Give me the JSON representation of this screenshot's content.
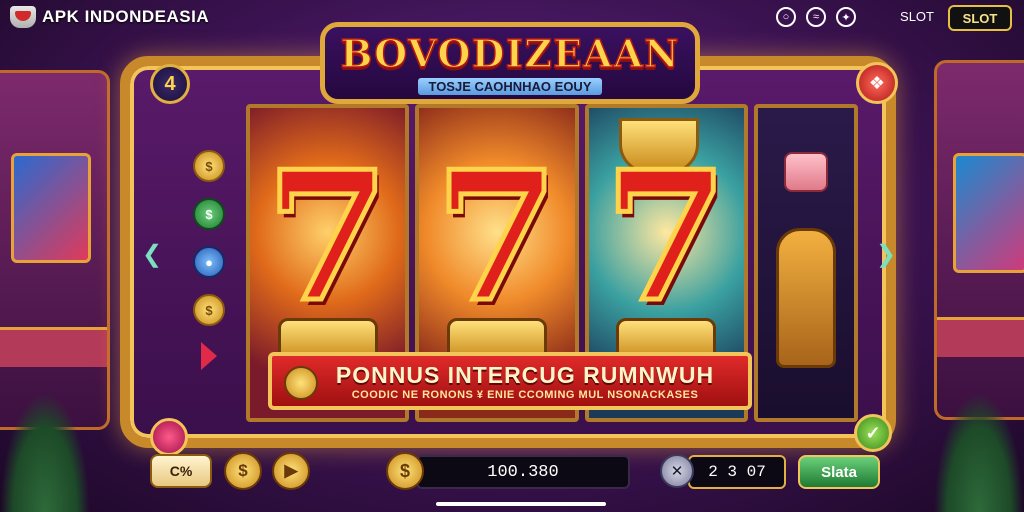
{
  "header": {
    "brand": "APK INDONDEASIA",
    "icons": [
      "chat-icon",
      "signal-icon",
      "gift-icon"
    ],
    "slot_label": "SLOT",
    "slot_button": "SLOT"
  },
  "machine": {
    "title": "BOVODIZEAAN",
    "subtitle": "TOSJE CAOHNHAO EOUY",
    "level": "4",
    "reels": [
      {
        "symbol": "7"
      },
      {
        "symbol": "7"
      },
      {
        "symbol": "7"
      }
    ],
    "left_symbols": [
      "coin-icon",
      "green-coin-icon",
      "blue-coin-icon",
      "coin-icon",
      "red-gem-icon"
    ]
  },
  "bonus": {
    "title": "PONNUS INTERCUG RUMNWUH",
    "subtitle": "COODIC NE RONONS ¥ ENIE CCOMING MUL NSONACKASES"
  },
  "footer": {
    "bet_label": "C%",
    "balance": "100.380",
    "bet_value": "2 3 07",
    "spin_label": "Slata"
  },
  "colors": {
    "frame_gold": "#c8892a",
    "reel_red": "#e0201a",
    "bonus_red": "#a01010",
    "spin_green": "#1e7a32"
  }
}
